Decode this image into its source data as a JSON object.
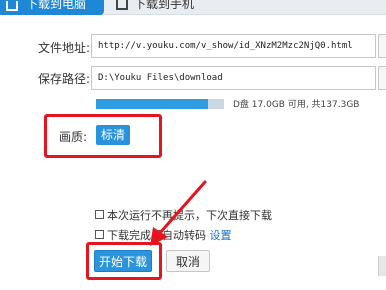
{
  "tabs": [
    {
      "label": "下载到电脑",
      "active": true
    },
    {
      "label": "下载到手机",
      "active": false
    }
  ],
  "form": {
    "url_label": "文件地址:",
    "url_value": "http://v.youku.com/v_show/id_XNzM2Mzc2NjQ0.html",
    "path_label": "保存路径:",
    "path_value": "D:\\Youku Files\\download"
  },
  "disk": {
    "info": "D盘  17.0GB 可用, 共137.3GB",
    "used_fraction": 0.876
  },
  "quality": {
    "label": "画质:",
    "selected": "标清"
  },
  "options": {
    "no_prompt_label": "本次运行不再提示，下次直接下载",
    "auto_convert_label": "下载完成后自动转码",
    "settings_link": "设置"
  },
  "buttons": {
    "start_label": "开始下载",
    "cancel_label": "取消"
  },
  "colors": {
    "accent": "#2a94de",
    "annotation": "#e5141e"
  }
}
